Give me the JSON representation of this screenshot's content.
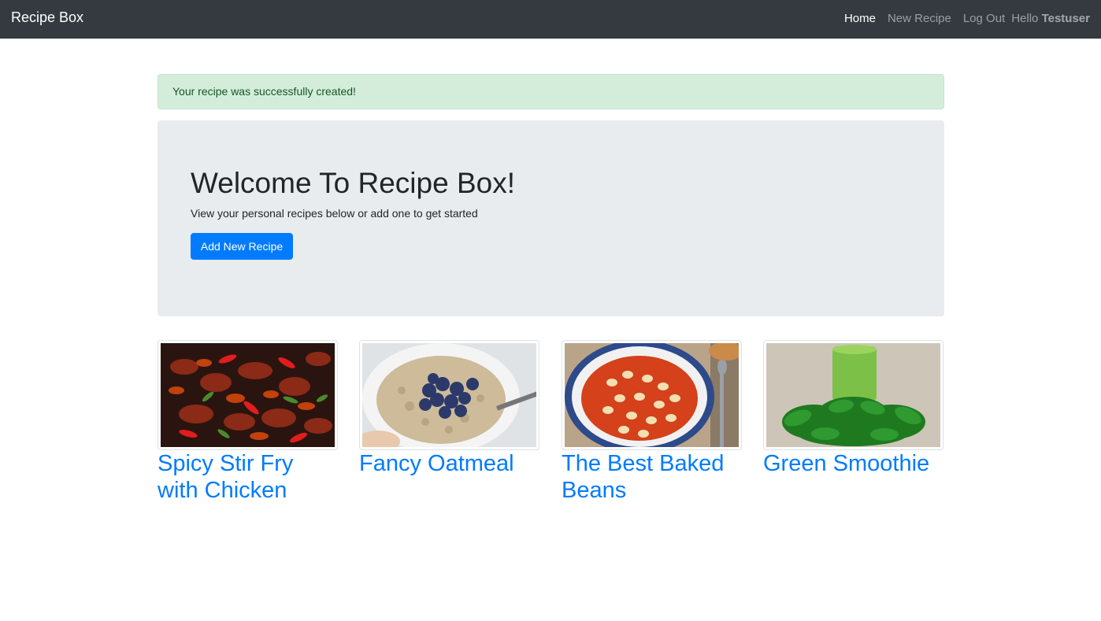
{
  "navbar": {
    "brand": "Recipe Box",
    "links": [
      {
        "label": "Home"
      },
      {
        "label": "New Recipe"
      },
      {
        "label": "Log Out"
      }
    ],
    "hello_prefix": "Hello",
    "username": "Testuser"
  },
  "alert": {
    "message": "Your recipe was successfully created!"
  },
  "jumbotron": {
    "title": "Welcome To Recipe Box!",
    "lead": "View your personal recipes below or add one to get started",
    "button_label": "Add New Recipe"
  },
  "recipes": [
    {
      "title": "Spicy Stir Fry with Chicken",
      "image_icon": "stir-fry-photo"
    },
    {
      "title": "Fancy Oatmeal",
      "image_icon": "oatmeal-photo"
    },
    {
      "title": "The Best Baked Beans",
      "image_icon": "baked-beans-photo"
    },
    {
      "title": "Green Smoothie",
      "image_icon": "green-smoothie-photo"
    }
  ],
  "colors": {
    "navbar_bg": "#343a40",
    "alert_bg": "#d4edda",
    "alert_text": "#155724",
    "jumbotron_bg": "#e9ecef",
    "primary": "#007bff"
  }
}
